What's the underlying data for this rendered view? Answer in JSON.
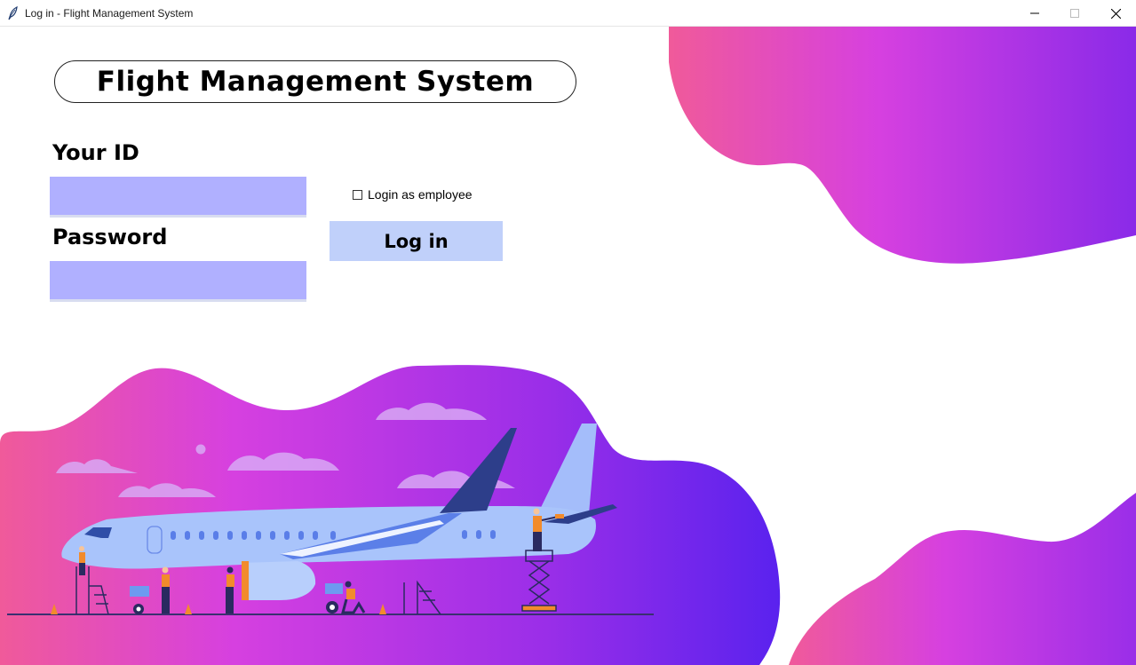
{
  "window": {
    "title": "Log in - Flight Management System",
    "app_icon": "feather-icon",
    "controls": [
      "minimize-icon",
      "maximize-icon",
      "close-icon"
    ]
  },
  "header": {
    "title": "Flight Management System"
  },
  "form": {
    "id_label": "Your ID",
    "id_value": "",
    "password_label": "Password",
    "password_value": "",
    "employee_checkbox_label": "Login as employee",
    "employee_checked": false,
    "login_button_label": "Log in"
  },
  "colors": {
    "field_bg": "#b0b0ff",
    "button_bg": "#c0d0fa",
    "gradient_start": "#f05a9a",
    "gradient_mid": "#d640e0",
    "gradient_end": "#6a26f0"
  }
}
